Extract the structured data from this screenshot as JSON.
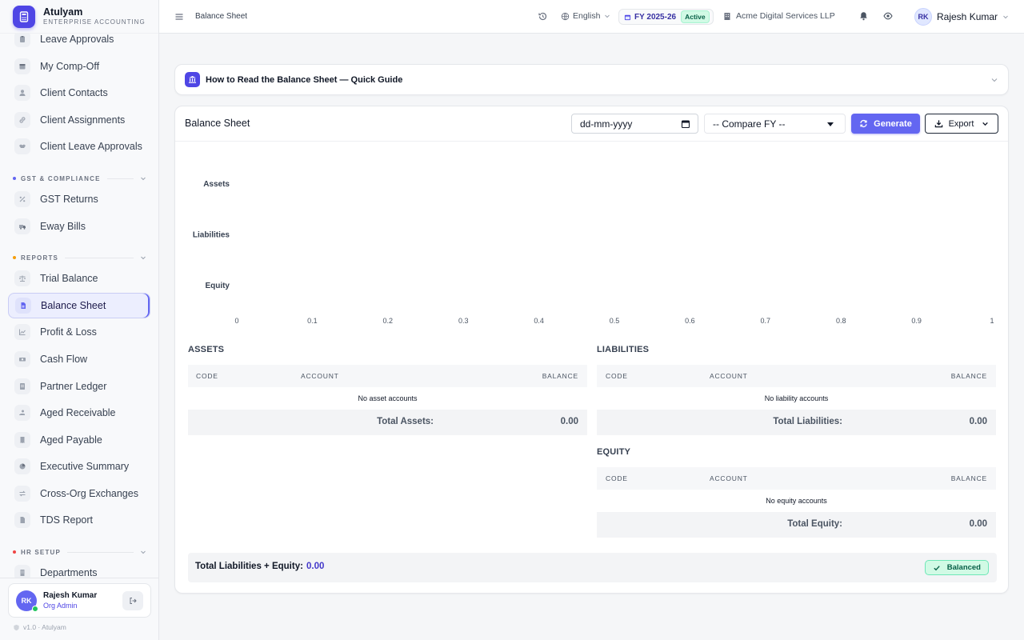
{
  "app": {
    "name": "Atulyam",
    "subtitle": "ENTERPRISE ACCOUNTING",
    "version": "v1.0 · Atulyam"
  },
  "sidebar": {
    "items_top": [
      {
        "label": "Leave Approvals",
        "icon": "clipboard-icon"
      },
      {
        "label": "My Comp-Off",
        "icon": "calendar-icon"
      },
      {
        "label": "Client Contacts",
        "icon": "user-icon"
      },
      {
        "label": "Client Assignments",
        "icon": "link-icon"
      },
      {
        "label": "Client Leave Approvals",
        "icon": "handshake-icon"
      }
    ],
    "sections": [
      {
        "label": "GST & COMPLIANCE",
        "color": "#6366f1"
      },
      {
        "label": "REPORTS",
        "color": "#f59e0b"
      },
      {
        "label": "HR SETUP",
        "color": "#ef4444"
      }
    ],
    "gst_items": [
      {
        "label": "GST Returns",
        "icon": "percent-icon"
      },
      {
        "label": "Eway Bills",
        "icon": "truck-icon"
      }
    ],
    "report_items": [
      {
        "label": "Trial Balance",
        "icon": "scale-icon"
      },
      {
        "label": "Balance Sheet",
        "icon": "document-icon"
      },
      {
        "label": "Profit & Loss",
        "icon": "line-chart-icon"
      },
      {
        "label": "Cash Flow",
        "icon": "money-icon"
      },
      {
        "label": "Partner Ledger",
        "icon": "ledger-icon"
      },
      {
        "label": "Aged Receivable",
        "icon": "hand-coin-icon"
      },
      {
        "label": "Aged Payable",
        "icon": "invoice-icon"
      },
      {
        "label": "Executive Summary",
        "icon": "pie-chart-icon"
      },
      {
        "label": "Cross-Org Exchanges",
        "icon": "exchange-icon"
      },
      {
        "label": "TDS Report",
        "icon": "file-icon"
      }
    ],
    "hr_items": [
      {
        "label": "Departments",
        "icon": "building-icon"
      }
    ],
    "active": "Balance Sheet"
  },
  "user": {
    "initials": "RK",
    "name": "Rajesh Kumar",
    "role": "Org Admin"
  },
  "topbar": {
    "breadcrumb": "Balance Sheet",
    "language": "English",
    "fy": "FY 2025-26",
    "fy_status": "Active",
    "org": "Acme Digital Services LLP",
    "user_initials": "RK",
    "user_name": "Rajesh Kumar"
  },
  "guide": {
    "title": "How to Read the Balance Sheet — Quick Guide"
  },
  "report": {
    "title": "Balance Sheet",
    "date_placeholder": "dd-mm-yyyy",
    "compare_select": "-- Compare FY --",
    "generate_label": "Generate",
    "export_label": "Export"
  },
  "chart_data": {
    "type": "bar",
    "orientation": "horizontal",
    "categories": [
      "Assets",
      "Liabilities",
      "Equity"
    ],
    "values": [
      0,
      0,
      0
    ],
    "xlim": [
      0,
      1
    ],
    "xticks": [
      "0",
      "0.1",
      "0.2",
      "0.3",
      "0.4",
      "0.5",
      "0.6",
      "0.7",
      "0.8",
      "0.9",
      "1"
    ],
    "grid": false
  },
  "tables": {
    "columns": {
      "code": "CODE",
      "account": "ACCOUNT",
      "balance": "BALANCE"
    },
    "assets": {
      "title": "ASSETS",
      "empty": "No asset accounts",
      "total_label": "Total Assets:",
      "total": "0.00"
    },
    "liabilities": {
      "title": "LIABILITIES",
      "empty": "No liability accounts",
      "total_label": "Total Liabilities:",
      "total": "0.00"
    },
    "equity": {
      "title": "EQUITY",
      "empty": "No equity accounts",
      "total_label": "Total Equity:",
      "total": "0.00"
    }
  },
  "summary": {
    "label": "Total Liabilities + Equity:",
    "value": "0.00",
    "status": "Balanced"
  },
  "colors": {
    "accent": "#6366f1",
    "success_bg": "#d1fae5",
    "success_text": "#065f46"
  }
}
